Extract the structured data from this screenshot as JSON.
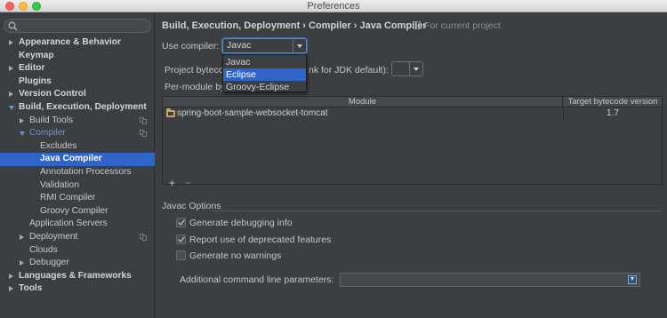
{
  "window": {
    "title": "Preferences"
  },
  "sidebar": {
    "search_placeholder": "",
    "items": [
      {
        "label": "Appearance & Behavior",
        "bold": true,
        "arrow": "right",
        "indent": 0
      },
      {
        "label": "Keymap",
        "bold": true,
        "indent": 0
      },
      {
        "label": "Editor",
        "bold": true,
        "arrow": "right",
        "indent": 0
      },
      {
        "label": "Plugins",
        "bold": true,
        "indent": 0
      },
      {
        "label": "Version Control",
        "bold": true,
        "arrow": "right",
        "indent": 0
      },
      {
        "label": "Build, Execution, Deployment",
        "bold": true,
        "arrow": "down",
        "indent": 0
      },
      {
        "label": "Build Tools",
        "arrow": "right",
        "indent": 1,
        "copy": true
      },
      {
        "label": "Compiler",
        "arrow": "down",
        "indent": 1,
        "copy": true,
        "blue": true
      },
      {
        "label": "Excludes",
        "indent": 2
      },
      {
        "label": "Java Compiler",
        "indent": 2,
        "selected": true
      },
      {
        "label": "Annotation Processors",
        "indent": 2
      },
      {
        "label": "Validation",
        "indent": 2
      },
      {
        "label": "RMI Compiler",
        "indent": 2
      },
      {
        "label": "Groovy Compiler",
        "indent": 2
      },
      {
        "label": "Application Servers",
        "indent": 1
      },
      {
        "label": "Deployment",
        "arrow": "right",
        "indent": 1,
        "copy": true
      },
      {
        "label": "Clouds",
        "indent": 1
      },
      {
        "label": "Debugger",
        "arrow": "right",
        "indent": 1
      },
      {
        "label": "Languages & Frameworks",
        "bold": true,
        "arrow": "right",
        "indent": 0
      },
      {
        "label": "Tools",
        "bold": true,
        "arrow": "right",
        "indent": 0
      }
    ]
  },
  "breadcrumb": {
    "path": "Build, Execution, Deployment › Compiler › Java Compiler",
    "scope": "For current project"
  },
  "compiler": {
    "use_compiler_label": "Use compiler:",
    "use_compiler_value": "Javac",
    "options": [
      "Javac",
      "Eclipse",
      "Groovy-Eclipse"
    ],
    "highlighted_option": "Eclipse",
    "bytecode_label_start": "Project bytecod",
    "bytecode_label_end": "nk for JDK default):",
    "per_module_label": "Per-module by"
  },
  "table": {
    "columns": [
      "Module",
      "Target bytecode version"
    ],
    "rows": [
      {
        "module": "spring-boot-sample-websocket-tomcat",
        "target": "1.7"
      }
    ],
    "add": "+",
    "remove": "−"
  },
  "javac_options": {
    "heading": "Javac Options",
    "debug_label": "Generate debugging info",
    "debug_checked": true,
    "deprecated_label": "Report use of deprecated features",
    "deprecated_checked": true,
    "nowarn_label": "Generate no warnings",
    "nowarn_checked": false,
    "params_label": "Additional command line parameters:",
    "params_value": ""
  }
}
